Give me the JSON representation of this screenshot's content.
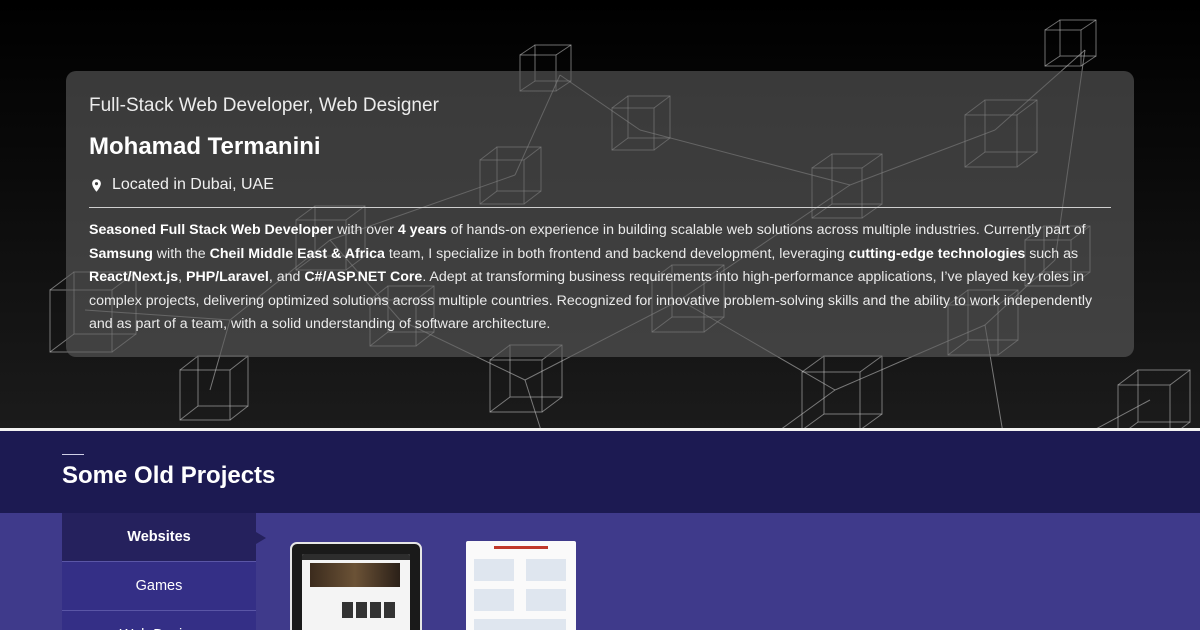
{
  "profile": {
    "role": "Full-Stack Web Developer, Web Designer",
    "name": "Mohamad Termanini",
    "location": "Located in Dubai, UAE",
    "bio": {
      "p1b": "Seasoned Full Stack Web Developer",
      "p2": " with over ",
      "p3b": "4 years",
      "p4": " of hands-on experience in building scalable web solutions across multiple industries. Currently part of ",
      "p5b": "Samsung",
      "p6": " with the ",
      "p7b": "Cheil Middle East & Africa",
      "p8": " team, I specialize in both frontend and backend development, leveraging ",
      "p9b": "cutting-edge technologies",
      "p10": " such as ",
      "p11b": "React/Next.js",
      "p12": ", ",
      "p13b": "PHP/Laravel",
      "p14": ", and ",
      "p15b": "C#/ASP.NET Core",
      "p16": ". Adept at transforming business requirements into high-performance applications, I’ve played key roles in complex projects, delivering optimized solutions across multiple countries. Recognized for innovative problem-solving skills and the ability to work independently and as part of a team, with a solid understanding of software architecture."
    }
  },
  "projects": {
    "title": "Some Old Projects",
    "tabs": [
      "Websites",
      "Games",
      "Web Design"
    ],
    "active_tab": "Websites"
  },
  "icons": {
    "location": "map-pin-icon"
  },
  "colors": {
    "projects_header": "#1c1a52",
    "projects_body": "#3f3a8b",
    "active_tab": "#25215d"
  }
}
